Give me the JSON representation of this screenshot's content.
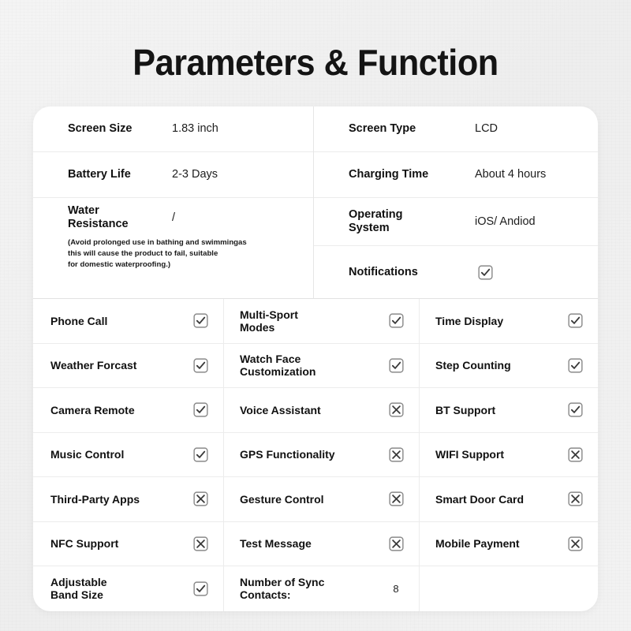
{
  "page": {
    "title": "Parameters & Function",
    "background_color": "#f1f1f1",
    "card_color": "#ffffff",
    "text_color": "#111111"
  },
  "spec": {
    "left": [
      {
        "label": "Screen Size",
        "value": "1.83 inch"
      },
      {
        "label": "Battery Life",
        "value": "2-3 Days"
      },
      {
        "label": "Water Resistance",
        "label_line1": "Water",
        "label_line2": "Resistance",
        "value": "/"
      }
    ],
    "note": "(Avoid prolonged use in bathing and swimmingas this will cause the product to fail, suitable for domestic waterproofing.)",
    "note_lines": [
      "(Avoid prolonged use in bathing and swimmingas",
      "this will cause the product to fail, suitable",
      "for domestic waterproofing.)"
    ],
    "right": [
      {
        "label": "Screen Type",
        "value": "LCD",
        "mark": "none"
      },
      {
        "label": "Charging Time",
        "value": "About 4 hours",
        "mark": "none"
      },
      {
        "label": "Operating System",
        "label_line1": "Operating",
        "label_line2": "System",
        "value": "iOS/ Andiod",
        "mark": "none"
      },
      {
        "label": "Notifications",
        "value": "",
        "mark": "check"
      }
    ]
  },
  "features": {
    "rows": [
      {
        "c1": {
          "label": "Phone Call",
          "mark": "check"
        },
        "c2": {
          "label": "Multi-Sport Modes",
          "line1": "Multi-Sport",
          "line2": "Modes",
          "mark": "check"
        },
        "c3": {
          "label": "Time Display",
          "mark": "check"
        }
      },
      {
        "c1": {
          "label": "Weather Forcast",
          "mark": "check"
        },
        "c2": {
          "label": "Watch Face Customization",
          "line1": "Watch Face",
          "line2": "Customization",
          "mark": "check"
        },
        "c3": {
          "label": "Step Counting",
          "mark": "check"
        }
      },
      {
        "c1": {
          "label": "Camera Remote",
          "mark": "check"
        },
        "c2": {
          "label": "Voice Assistant",
          "mark": "cross"
        },
        "c3": {
          "label": "BT Support",
          "mark": "check"
        }
      },
      {
        "c1": {
          "label": "Music Control",
          "mark": "check"
        },
        "c2": {
          "label": "GPS Functionality",
          "mark": "cross"
        },
        "c3": {
          "label": "WIFI Support",
          "mark": "cross"
        }
      },
      {
        "c1": {
          "label": "Third-Party Apps",
          "mark": "cross"
        },
        "c2": {
          "label": "Gesture Control",
          "mark": "cross"
        },
        "c3": {
          "label": "Smart Door Card",
          "mark": "cross"
        }
      },
      {
        "c1": {
          "label": "NFC Support",
          "mark": "cross"
        },
        "c2": {
          "label": "Test Message",
          "mark": "cross"
        },
        "c3": {
          "label": "Mobile Payment",
          "mark": "cross"
        }
      },
      {
        "c1": {
          "label": "Adjustable Band Size",
          "line1": "Adjustable",
          "line2": "Band Size",
          "mark": "check"
        },
        "c2": {
          "label": "Number of Sync Contacts:",
          "line1": "Number of Sync",
          "line2": "Contacts:",
          "value": "8",
          "mark": "none"
        },
        "c3": {
          "label": "",
          "mark": "none"
        }
      }
    ]
  },
  "icons": {
    "check": "checkbox-checked-icon",
    "cross": "checkbox-crossed-icon",
    "border_color": "#8a8a8a",
    "glyph_color": "#3a3a3a"
  }
}
